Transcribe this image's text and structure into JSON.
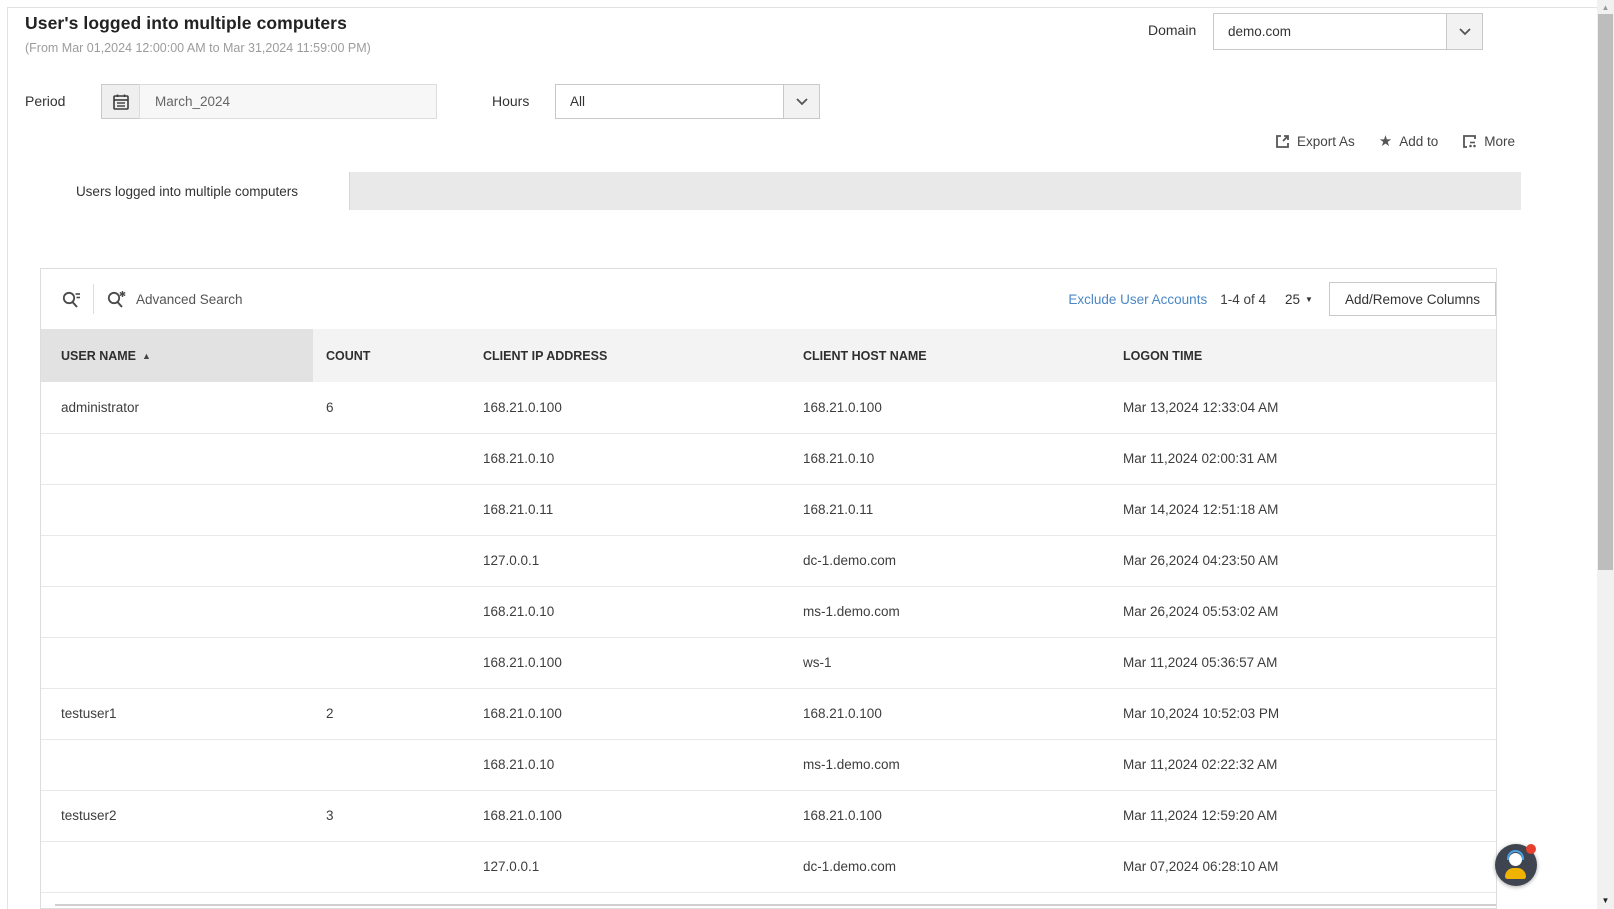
{
  "header": {
    "title": "User's logged into multiple computers",
    "subtitle": "(From Mar 01,2024 12:00:00 AM to Mar 31,2024 11:59:00 PM)",
    "domain": {
      "label": "Domain",
      "value": "demo.com"
    }
  },
  "filters": {
    "period": {
      "label": "Period",
      "value": "March_2024"
    },
    "hours": {
      "label": "Hours",
      "value": "All"
    }
  },
  "actions": {
    "export_as": "Export As",
    "add_to": "Add to",
    "more": "More"
  },
  "tab": {
    "label": "Users logged into multiple computers"
  },
  "toolbar": {
    "advanced_search": "Advanced Search",
    "exclude_user_accounts": "Exclude User Accounts",
    "result_range": "1-4 of 4",
    "page_size": "25",
    "add_remove_columns": "Add/Remove Columns"
  },
  "table": {
    "columns": [
      "USER NAME",
      "COUNT",
      "CLIENT IP ADDRESS",
      "CLIENT HOST NAME",
      "LOGON TIME"
    ],
    "sorted_column": "USER NAME",
    "sort_direction": "ascending",
    "rows": [
      [
        "administrator",
        "6",
        "168.21.0.100",
        "168.21.0.100",
        "Mar 13,2024 12:33:04 AM"
      ],
      [
        "",
        "",
        "168.21.0.10",
        "168.21.0.10",
        "Mar 11,2024 02:00:31 AM"
      ],
      [
        "",
        "",
        "168.21.0.11",
        "168.21.0.11",
        "Mar 14,2024 12:51:18 AM"
      ],
      [
        "",
        "",
        "127.0.0.1",
        "dc-1.demo.com",
        "Mar 26,2024 04:23:50 AM"
      ],
      [
        "",
        "",
        "168.21.0.10",
        "ms-1.demo.com",
        "Mar 26,2024 05:53:02 AM"
      ],
      [
        "",
        "",
        "168.21.0.100",
        "ws-1",
        "Mar 11,2024 05:36:57 AM"
      ],
      [
        "testuser1",
        "2",
        "168.21.0.100",
        "168.21.0.100",
        "Mar 10,2024 10:52:03 PM"
      ],
      [
        "",
        "",
        "168.21.0.10",
        "ms-1.demo.com",
        "Mar 11,2024 02:22:32 AM"
      ],
      [
        "testuser2",
        "3",
        "168.21.0.100",
        "168.21.0.100",
        "Mar 11,2024 12:59:20 AM"
      ],
      [
        "",
        "",
        "127.0.0.1",
        "dc-1.demo.com",
        "Mar 07,2024 06:28:10 AM"
      ]
    ]
  },
  "glyphs": {
    "star": "★",
    "sort_asc": "▲",
    "caret_down": "▼",
    "scroll_up": "▲",
    "scroll_down": "▼"
  },
  "colors": {
    "link_blue": "#4a87c6",
    "notification_red": "#e8402e",
    "support_bubble_dark": "#3e4551",
    "support_body_yellow": "#f0b400",
    "support_headset_blue": "#4aa3e0"
  }
}
